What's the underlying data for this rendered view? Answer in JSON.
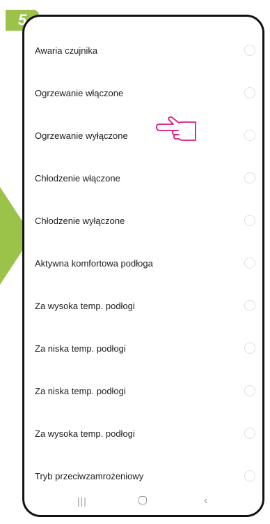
{
  "step": {
    "number": "5"
  },
  "options": [
    {
      "label": "Awaria czujnika"
    },
    {
      "label": "Ogrzewanie włączone"
    },
    {
      "label": "Ogrzewanie wyłączone"
    },
    {
      "label": "Chłodzenie włączone"
    },
    {
      "label": "Chłodzenie wyłączone"
    },
    {
      "label": "Aktywna komfortowa podłoga"
    },
    {
      "label": "Za wysoka temp. podłogi"
    },
    {
      "label": "Za niska temp. podłogi"
    },
    {
      "label": "Za niska temp. podłogi"
    },
    {
      "label": "Za wysoka temp. podłogi"
    },
    {
      "label": "Tryb przeciwzamrożeniowy"
    }
  ],
  "nav": {
    "recents_glyph": "|||",
    "back_glyph": "‹"
  },
  "colors": {
    "accent_green": "#9bc34a",
    "pointer_magenta": "#e0157a",
    "phone_frame": "#111111"
  },
  "icons": {
    "pointer": "pointing-hand-icon",
    "recents": "recents-icon",
    "home": "home-icon",
    "back": "back-icon"
  }
}
